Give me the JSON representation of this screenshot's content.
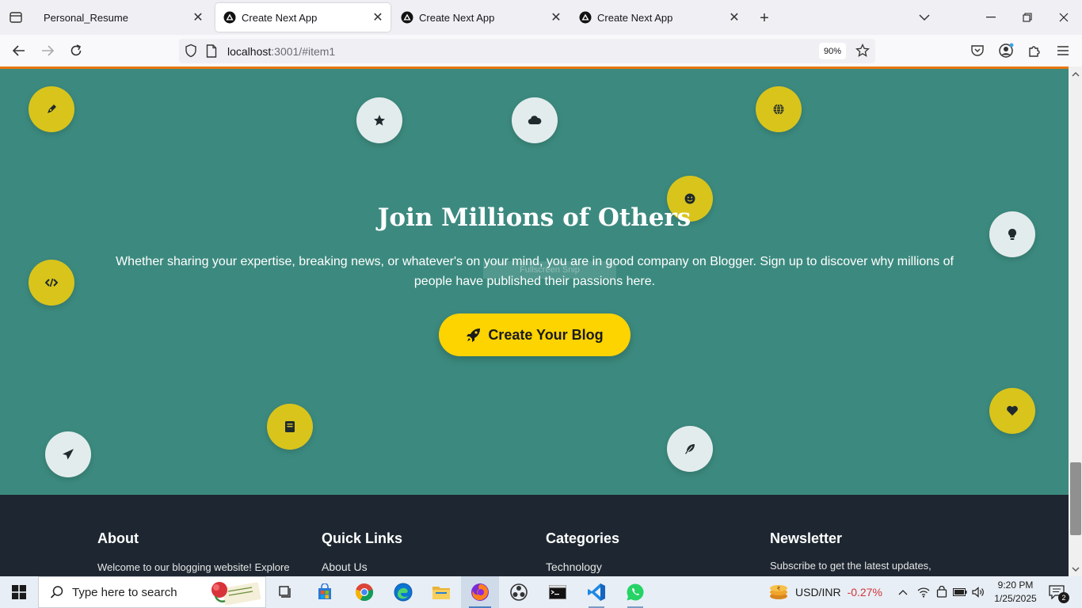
{
  "browser": {
    "tabs": [
      {
        "title": "Personal_Resume",
        "active": false
      },
      {
        "title": "Create Next App",
        "active": true
      },
      {
        "title": "Create Next App",
        "active": false
      },
      {
        "title": "Create Next App",
        "active": false
      }
    ],
    "url_host": "localhost",
    "url_rest": ":3001/#item1",
    "zoom": "90%"
  },
  "hero": {
    "title": "Join Millions of Others",
    "description": "Whether sharing your expertise, breaking news, or whatever's on your mind, you are in good company on Blogger. Sign up to discover why millions of people have published their passions here.",
    "cta_label": "Create Your Blog",
    "ghost_overlay_text": "Fullscreen Snip",
    "bubble_icons": [
      "pen-icon",
      "star-icon",
      "cloud-icon",
      "globe-icon",
      "smile-icon",
      "lightbulb-icon",
      "code-icon",
      "heart-icon",
      "book-icon",
      "paper-plane-icon",
      "feather-icon"
    ]
  },
  "footer": {
    "about": {
      "heading": "About",
      "text": "Welcome to our blogging website! Explore"
    },
    "quick_links": {
      "heading": "Quick Links",
      "first_link": "About Us"
    },
    "categories": {
      "heading": "Categories",
      "first_link": "Technology"
    },
    "newsletter": {
      "heading": "Newsletter",
      "text": "Subscribe to get the latest updates,"
    }
  },
  "taskbar": {
    "search_placeholder": "Type here to search",
    "ticker_label": "USD/INR",
    "ticker_change": "-0.27%",
    "time": "9:20 PM",
    "date": "1/25/2025",
    "notification_count": "2"
  },
  "colors": {
    "hero_bg": "#3c8a7f",
    "accent_yellow": "#fdd300",
    "bubble_yellow": "#d9c41c",
    "footer_bg": "#1e2731",
    "accent_orange": "#e8760f"
  }
}
